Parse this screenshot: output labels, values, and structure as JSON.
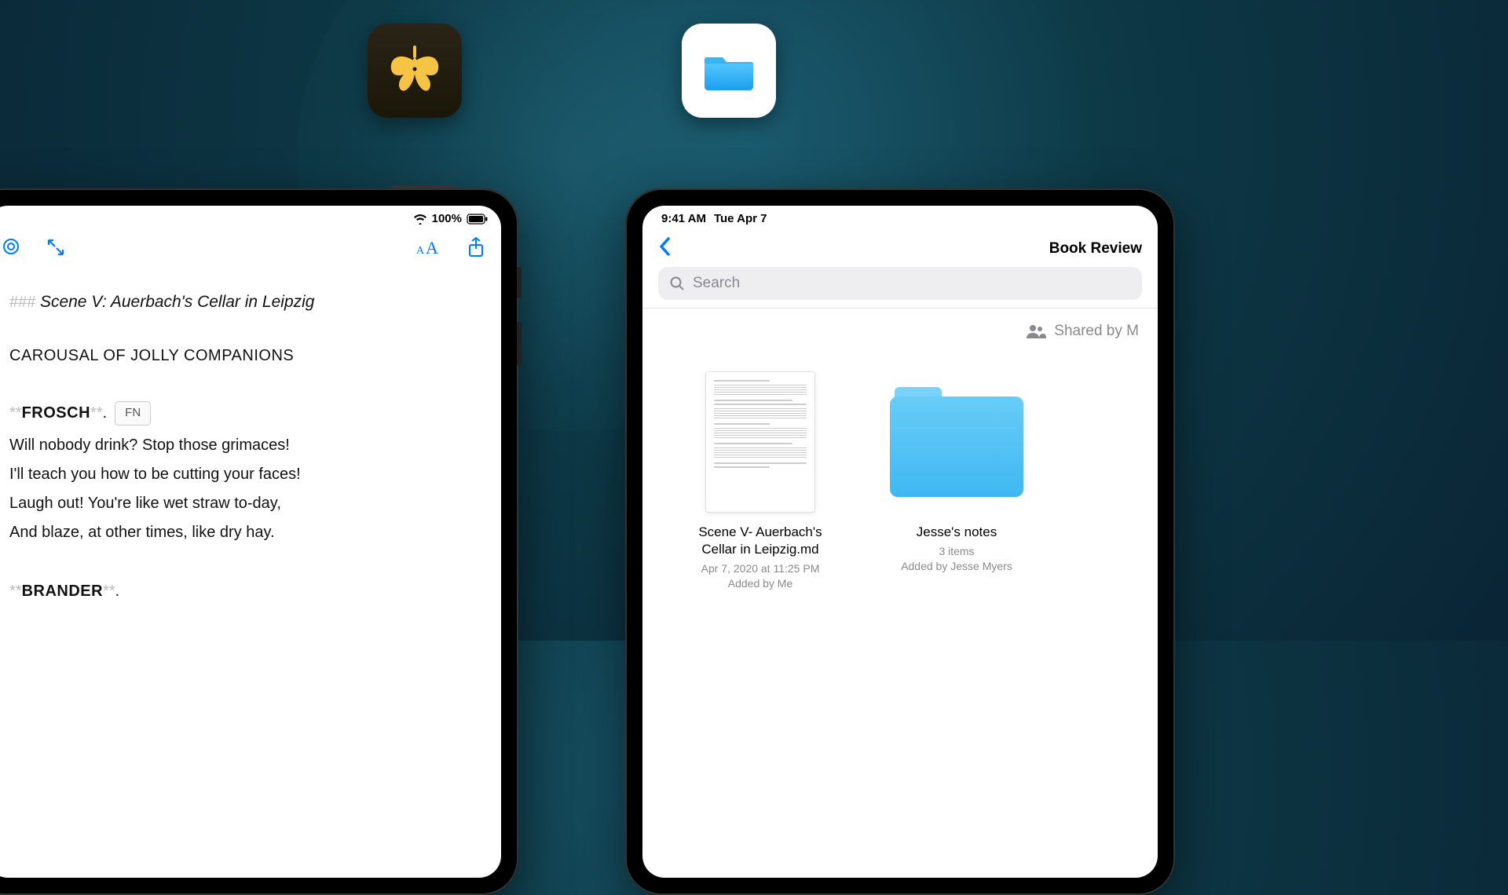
{
  "app_icons": {
    "ulysses": "ulysses-butterfly-icon",
    "files": "files-folder-icon"
  },
  "left_device": {
    "status": {
      "battery_pct": "100%"
    },
    "toolbar": {
      "search": "search-icon",
      "expand": "expand-icon",
      "text_format": "text-size-icon",
      "share": "share-icon"
    },
    "editor": {
      "heading_prefix": "###",
      "heading": "Scene V: Auerbach's Cellar in Leipzig",
      "subtitle": "CAROUSAL OF JOLLY COMPANIONS",
      "bold_marker": "**",
      "speaker1": "FROSCH",
      "fn_label": "FN",
      "verse1": [
        "Will nobody drink? Stop those grimaces!",
        "I'll teach you how to be cutting your faces!",
        "Laugh out! You're like wet straw to-day,",
        "And blaze, at other times, like dry hay."
      ],
      "speaker2": "BRANDER",
      "period": "."
    }
  },
  "right_device": {
    "status": {
      "time": "9:41 AM",
      "date": "Tue Apr 7"
    },
    "nav": {
      "back": "back-chevron",
      "title": "Book Review"
    },
    "search": {
      "placeholder": "Search"
    },
    "shared_label": "Shared by M",
    "files": [
      {
        "name_line1": "Scene V- Auerbach's",
        "name_line2": "Cellar in Leipzig.md",
        "meta_line1": "Apr 7, 2020 at 11:25 PM",
        "meta_line2": "Added by Me"
      },
      {
        "name_line1": "Jesse's notes",
        "meta_line1": "3 items",
        "meta_line2": "Added by Jesse Myers"
      }
    ]
  },
  "colors": {
    "ios_blue": "#007aff",
    "folder_blue": "#3fb8f2",
    "ulysses_gold": "#f5c444"
  }
}
